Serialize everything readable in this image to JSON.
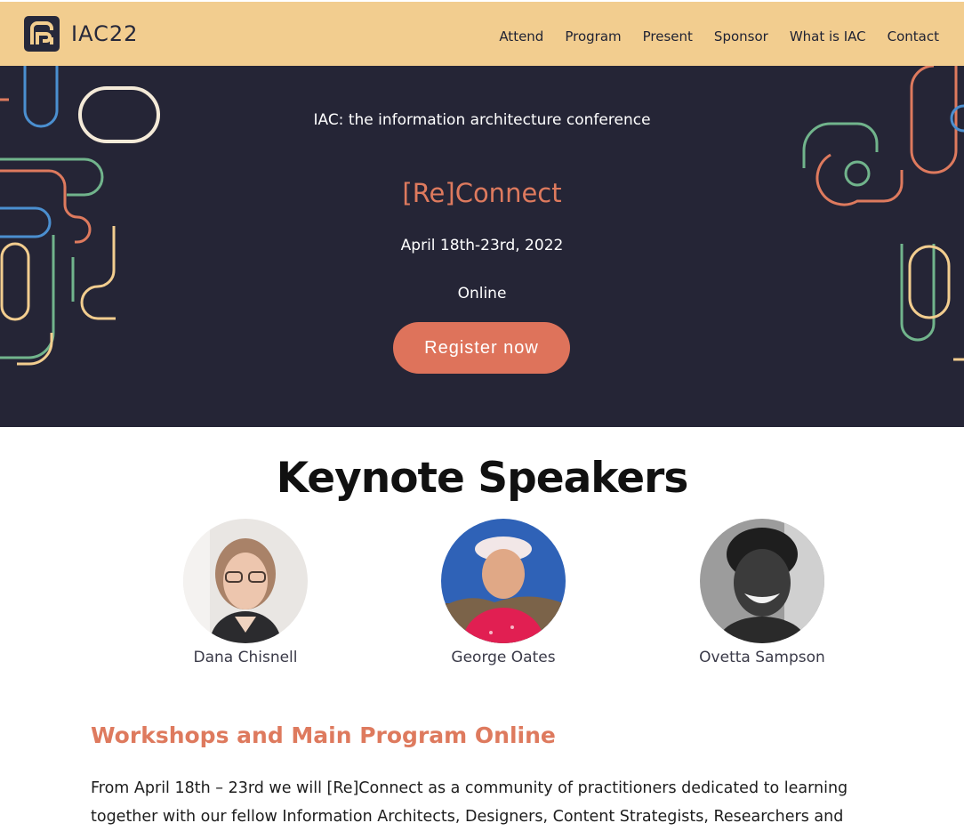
{
  "header": {
    "logo_text": "IAC22",
    "logo_icon": "iac-logo-mark",
    "nav": [
      {
        "label": "Attend"
      },
      {
        "label": "Program"
      },
      {
        "label": "Present"
      },
      {
        "label": "Sponsor"
      },
      {
        "label": "What is IAC"
      },
      {
        "label": "Contact"
      }
    ]
  },
  "hero": {
    "tagline": "IAC: the information architecture conference",
    "title": "[Re]Connect",
    "dates": "April 18th-23rd, 2022",
    "location": "Online",
    "register_label": "Register now"
  },
  "keynotes": {
    "heading": "Keynote Speakers",
    "speakers": [
      {
        "name": "Dana Chisnell"
      },
      {
        "name": "George Oates"
      },
      {
        "name": "Ovetta Sampson"
      }
    ]
  },
  "program": {
    "title": "Workshops and Main Program Online",
    "intro": "From April 18th – 23rd we will [Re]Connect as a community of practitioners dedicated to learning together with our fellow Information Architects, Designers, Content Strategists, Researchers and"
  },
  "colors": {
    "header_bg": "#f2cd8f",
    "hero_bg": "#252536",
    "accent": "#de7a5e",
    "text_dark": "#1f2233"
  }
}
